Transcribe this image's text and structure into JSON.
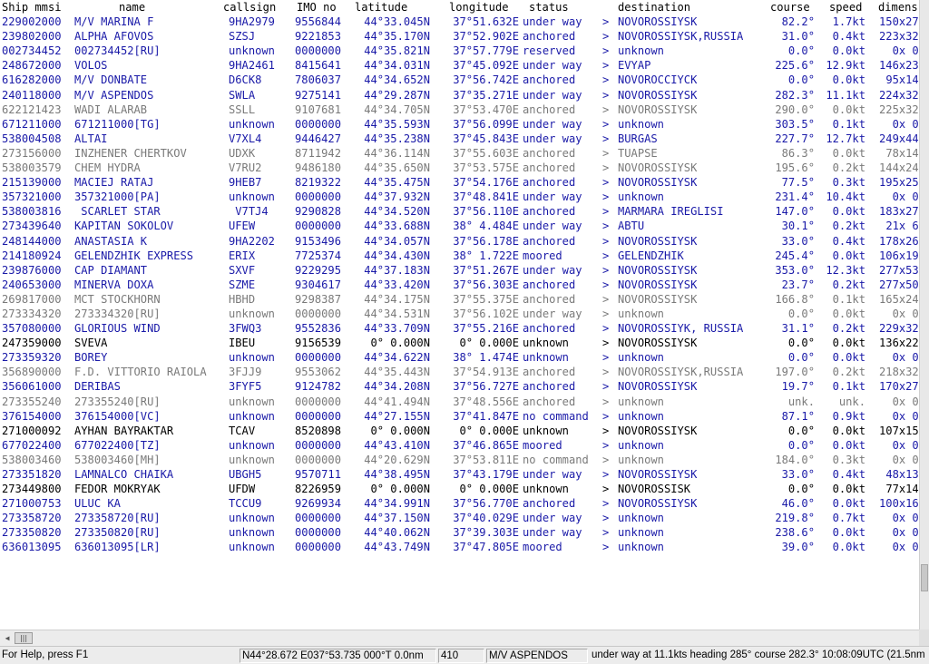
{
  "colors": {
    "moving_text": "#1a1aa8",
    "stationary_text": "#000000",
    "stale_text": "#7a7a7a",
    "header_text": "#000000",
    "background": "#ffffff"
  },
  "table": {
    "columns": [
      "Ship mmsi",
      "name",
      "callsign",
      "IMO no",
      "latitude",
      "longitude",
      "status",
      "destination",
      "course",
      "speed",
      "dimens"
    ],
    "rows": [
      {
        "style": "moving",
        "mmsi": "229002000",
        "name": "M/V MARINA F",
        "callsign": "9HA2979",
        "imo": "9556844",
        "lat": "44°33.045N",
        "lon": "37°51.632E",
        "status": "under way",
        "arrow": ">",
        "dest": "NOVOROSSIYSK",
        "course": "82.2°",
        "speed": "1.7kt",
        "dim": "150x27x"
      },
      {
        "style": "moving",
        "mmsi": "239802000",
        "name": "ALPHA AFOVOS",
        "callsign": "SZSJ",
        "imo": "9221853",
        "lat": "44°35.170N",
        "lon": "37°52.902E",
        "status": "anchored",
        "arrow": ">",
        "dest": "NOVOROSSIYSK,RUSSIA",
        "course": "31.0°",
        "speed": "0.4kt",
        "dim": "223x32x"
      },
      {
        "style": "moving",
        "mmsi": "002734452",
        "name": "002734452[RU]",
        "callsign": "unknown",
        "imo": "0000000",
        "lat": "44°35.821N",
        "lon": "37°57.779E",
        "status": "reserved",
        "arrow": ">",
        "dest": "unknown",
        "course": "0.0°",
        "speed": "0.0kt",
        "dim": "0x 0x"
      },
      {
        "style": "moving",
        "mmsi": "248672000",
        "name": "VOLOS",
        "callsign": "9HA2461",
        "imo": "8415641",
        "lat": "44°34.031N",
        "lon": "37°45.092E",
        "status": "under way",
        "arrow": ">",
        "dest": "EVYAP",
        "course": "225.6°",
        "speed": "12.9kt",
        "dim": "146x23x"
      },
      {
        "style": "moving",
        "mmsi": "616282000",
        "name": "M/V DONBATE",
        "callsign": "D6CK8",
        "imo": "7806037",
        "lat": "44°34.652N",
        "lon": "37°56.742E",
        "status": "anchored",
        "arrow": ">",
        "dest": "NOVOROCCIYCK",
        "course": "0.0°",
        "speed": "0.0kt",
        "dim": "95x14x"
      },
      {
        "style": "moving",
        "mmsi": "240118000",
        "name": "M/V ASPENDOS",
        "callsign": "SWLA",
        "imo": "9275141",
        "lat": "44°29.287N",
        "lon": "37°35.271E",
        "status": "under way",
        "arrow": ">",
        "dest": "NOVOROSSIYSK",
        "course": "282.3°",
        "speed": "11.1kt",
        "dim": "224x32x"
      },
      {
        "style": "stale",
        "mmsi": "622121423",
        "name": "WADI ALARAB",
        "callsign": "SSLL",
        "imo": "9107681",
        "lat": "44°34.705N",
        "lon": "37°53.470E",
        "status": "anchored",
        "arrow": ">",
        "dest": "NOVOROSSIYSK",
        "course": "290.0°",
        "speed": "0.0kt",
        "dim": "225x32x"
      },
      {
        "style": "moving",
        "mmsi": "671211000",
        "name": "671211000[TG]",
        "callsign": "unknown",
        "imo": "0000000",
        "lat": "44°35.593N",
        "lon": "37°56.099E",
        "status": "under way",
        "arrow": ">",
        "dest": "unknown",
        "course": "303.5°",
        "speed": "0.1kt",
        "dim": "0x 0x"
      },
      {
        "style": "moving",
        "mmsi": "538004508",
        "name": "ALTAI",
        "callsign": "V7XL4",
        "imo": "9446427",
        "lat": "44°35.238N",
        "lon": "37°45.843E",
        "status": "under way",
        "arrow": ">",
        "dest": "BURGAS",
        "course": "227.7°",
        "speed": "12.7kt",
        "dim": "249x44x"
      },
      {
        "style": "stale",
        "mmsi": "273156000",
        "name": "INZHENER CHERTKOV",
        "callsign": "UDXK",
        "imo": "8711942",
        "lat": "44°36.114N",
        "lon": "37°55.603E",
        "status": "anchored",
        "arrow": ">",
        "dest": "TUAPSE",
        "course": "86.3°",
        "speed": "0.0kt",
        "dim": "78x14x"
      },
      {
        "style": "stale",
        "mmsi": "538003579",
        "name": "CHEM HYDRA",
        "callsign": "V7RU2",
        "imo": "9486180",
        "lat": "44°35.650N",
        "lon": "37°53.575E",
        "status": "anchored",
        "arrow": ">",
        "dest": "NOVOROSSIYSK",
        "course": "195.6°",
        "speed": "0.2kt",
        "dim": "144x24x"
      },
      {
        "style": "moving",
        "mmsi": "215139000",
        "name": "MACIEJ RATAJ",
        "callsign": "9HEB7",
        "imo": "8219322",
        "lat": "44°35.475N",
        "lon": "37°54.176E",
        "status": "anchored",
        "arrow": ">",
        "dest": "NOVOROSSIYSK",
        "course": "77.5°",
        "speed": "0.3kt",
        "dim": "195x25x"
      },
      {
        "style": "moving",
        "mmsi": "357321000",
        "name": "357321000[PA]",
        "callsign": "unknown",
        "imo": "0000000",
        "lat": "44°37.932N",
        "lon": "37°48.841E",
        "status": "under way",
        "arrow": ">",
        "dest": "unknown",
        "course": "231.4°",
        "speed": "10.4kt",
        "dim": "0x 0x"
      },
      {
        "style": "moving",
        "mmsi": "538003816",
        "name": " SCARLET STAR",
        "callsign": " V7TJ4",
        "imo": "9290828",
        "lat": "44°34.520N",
        "lon": "37°56.110E",
        "status": "anchored",
        "arrow": ">",
        "dest": "MARMARA IREGLISI",
        "course": "147.0°",
        "speed": "0.0kt",
        "dim": "183x27x"
      },
      {
        "style": "moving",
        "mmsi": "273439640",
        "name": "KAPITAN SOKOLOV",
        "callsign": "UFEW",
        "imo": "0000000",
        "lat": "44°33.688N",
        "lon": "38° 4.484E",
        "status": "under way",
        "arrow": ">",
        "dest": "ABTU",
        "course": "30.1°",
        "speed": "0.2kt",
        "dim": "21x 6x"
      },
      {
        "style": "moving",
        "mmsi": "248144000",
        "name": "ANASTASIA K",
        "callsign": "9HA2202",
        "imo": "9153496",
        "lat": "44°34.057N",
        "lon": "37°56.178E",
        "status": "anchored",
        "arrow": ">",
        "dest": "NOVOROSSIYSK",
        "course": "33.0°",
        "speed": "0.4kt",
        "dim": "178x26x"
      },
      {
        "style": "moving",
        "mmsi": "214180924",
        "name": "GELENDZHIK EXPRESS",
        "callsign": "ERIX",
        "imo": "7725374",
        "lat": "44°34.430N",
        "lon": "38° 1.722E",
        "status": "moored",
        "arrow": ">",
        "dest": "GELENDZHIK",
        "course": "245.4°",
        "speed": "0.0kt",
        "dim": "106x19x"
      },
      {
        "style": "moving",
        "mmsi": "239876000",
        "name": "CAP DIAMANT",
        "callsign": "SXVF",
        "imo": "9229295",
        "lat": "44°37.183N",
        "lon": "37°51.267E",
        "status": "under way",
        "arrow": ">",
        "dest": "NOVOROSSIYSK",
        "course": "353.0°",
        "speed": "12.3kt",
        "dim": "277x53x"
      },
      {
        "style": "moving",
        "mmsi": "240653000",
        "name": "MINERVA DOXA",
        "callsign": "SZME",
        "imo": "9304617",
        "lat": "44°33.420N",
        "lon": "37°56.303E",
        "status": "anchored",
        "arrow": ">",
        "dest": "NOVOROSSIYSK",
        "course": "23.7°",
        "speed": "0.2kt",
        "dim": "277x50x"
      },
      {
        "style": "stale",
        "mmsi": "269817000",
        "name": "MCT STOCKHORN",
        "callsign": "HBHD",
        "imo": "9298387",
        "lat": "44°34.175N",
        "lon": "37°55.375E",
        "status": "anchored",
        "arrow": ">",
        "dest": "NOVOROSSIYSK",
        "course": "166.8°",
        "speed": "0.1kt",
        "dim": "165x24x"
      },
      {
        "style": "stale",
        "mmsi": "273334320",
        "name": "273334320[RU]",
        "callsign": "unknown",
        "imo": "0000000",
        "lat": "44°34.531N",
        "lon": "37°56.102E",
        "status": "under way",
        "arrow": ">",
        "dest": "unknown",
        "course": "0.0°",
        "speed": "0.0kt",
        "dim": "0x 0x"
      },
      {
        "style": "moving",
        "mmsi": "357080000",
        "name": "GLORIOUS WIND",
        "callsign": "3FWQ3",
        "imo": "9552836",
        "lat": "44°33.709N",
        "lon": "37°55.216E",
        "status": "anchored",
        "arrow": ">",
        "dest": "NOVOROSSIYK, RUSSIA",
        "course": "31.1°",
        "speed": "0.2kt",
        "dim": "229x32x"
      },
      {
        "style": "dark",
        "mmsi": "247359000",
        "name": "SVEVA",
        "callsign": "IBEU",
        "imo": "9156539",
        "lat": "0° 0.000N",
        "lon": "0° 0.000E",
        "status": "unknown",
        "arrow": ">",
        "dest": "NOVOROSSIYSK",
        "course": "0.0°",
        "speed": "0.0kt",
        "dim": "136x22x"
      },
      {
        "style": "moving",
        "mmsi": "273359320",
        "name": "BOREY",
        "callsign": "unknown",
        "imo": "0000000",
        "lat": "44°34.622N",
        "lon": "38° 1.474E",
        "status": "unknown",
        "arrow": ">",
        "dest": "unknown",
        "course": "0.0°",
        "speed": "0.0kt",
        "dim": "0x 0x"
      },
      {
        "style": "stale",
        "mmsi": "356890000",
        "name": "F.D. VITTORIO RAIOLA",
        "callsign": "3FJJ9",
        "imo": "9553062",
        "lat": "44°35.443N",
        "lon": "37°54.913E",
        "status": "anchored",
        "arrow": ">",
        "dest": "NOVOROSSIYSK,RUSSIA",
        "course": "197.0°",
        "speed": "0.2kt",
        "dim": "218x32x"
      },
      {
        "style": "moving",
        "mmsi": "356061000",
        "name": "DERIBAS",
        "callsign": "3FYF5",
        "imo": "9124782",
        "lat": "44°34.208N",
        "lon": "37°56.727E",
        "status": "anchored",
        "arrow": ">",
        "dest": "NOVOROSSIYSK",
        "course": "19.7°",
        "speed": "0.1kt",
        "dim": "170x27x"
      },
      {
        "style": "stale",
        "mmsi": "273355240",
        "name": "273355240[RU]",
        "callsign": "unknown",
        "imo": "0000000",
        "lat": "44°41.494N",
        "lon": "37°48.556E",
        "status": "anchored",
        "arrow": ">",
        "dest": "unknown",
        "course": "unk.",
        "speed": "unk.",
        "dim": "0x 0x"
      },
      {
        "style": "moving",
        "mmsi": "376154000",
        "name": "376154000[VC]",
        "callsign": "unknown",
        "imo": "0000000",
        "lat": "44°27.155N",
        "lon": "37°41.847E",
        "status": "no command",
        "arrow": ">",
        "dest": "unknown",
        "course": "87.1°",
        "speed": "0.9kt",
        "dim": "0x 0x"
      },
      {
        "style": "dark",
        "mmsi": "271000092",
        "name": "AYHAN BAYRAKTAR",
        "callsign": "TCAV",
        "imo": "8520898",
        "lat": "0° 0.000N",
        "lon": "0° 0.000E",
        "status": "unknown",
        "arrow": ">",
        "dest": "NOVOROSSIYSK",
        "course": "0.0°",
        "speed": "0.0kt",
        "dim": "107x15x"
      },
      {
        "style": "moving",
        "mmsi": "677022400",
        "name": "677022400[TZ]",
        "callsign": "unknown",
        "imo": "0000000",
        "lat": "44°43.410N",
        "lon": "37°46.865E",
        "status": "moored",
        "arrow": ">",
        "dest": "unknown",
        "course": "0.0°",
        "speed": "0.0kt",
        "dim": "0x 0x"
      },
      {
        "style": "stale",
        "mmsi": "538003460",
        "name": "538003460[MH]",
        "callsign": "unknown",
        "imo": "0000000",
        "lat": "44°20.629N",
        "lon": "37°53.811E",
        "status": "no command",
        "arrow": ">",
        "dest": "unknown",
        "course": "184.0°",
        "speed": "0.3kt",
        "dim": "0x 0x"
      },
      {
        "style": "moving",
        "mmsi": "273351820",
        "name": "LAMNALCO CHAIKA",
        "callsign": "UBGH5",
        "imo": "9570711",
        "lat": "44°38.495N",
        "lon": "37°43.179E",
        "status": "under way",
        "arrow": ">",
        "dest": "NOVOROSSIYSK",
        "course": "33.0°",
        "speed": "0.4kt",
        "dim": "48x13x"
      },
      {
        "style": "dark",
        "mmsi": "273449800",
        "name": "FEDOR MOKRYAK",
        "callsign": "UFDW",
        "imo": "8226959",
        "lat": "0° 0.000N",
        "lon": "0° 0.000E",
        "status": "unknown",
        "arrow": ">",
        "dest": "NOVOROSSISK",
        "course": "0.0°",
        "speed": "0.0kt",
        "dim": "77x14x"
      },
      {
        "style": "moving",
        "mmsi": "271000753",
        "name": "ULUC KA",
        "callsign": "TCCU9",
        "imo": "9269934",
        "lat": "44°34.991N",
        "lon": "37°56.770E",
        "status": "anchored",
        "arrow": ">",
        "dest": "NOVOROSSIYSK",
        "course": "46.0°",
        "speed": "0.0kt",
        "dim": "100x16x"
      },
      {
        "style": "moving",
        "mmsi": "273358720",
        "name": "273358720[RU]",
        "callsign": "unknown",
        "imo": "0000000",
        "lat": "44°37.150N",
        "lon": "37°40.029E",
        "status": "under way",
        "arrow": ">",
        "dest": "unknown",
        "course": "219.8°",
        "speed": "0.7kt",
        "dim": "0x 0x"
      },
      {
        "style": "moving",
        "mmsi": "273350820",
        "name": "273350820[RU]",
        "callsign": "unknown",
        "imo": "0000000",
        "lat": "44°40.062N",
        "lon": "37°39.303E",
        "status": "under way",
        "arrow": ">",
        "dest": "unknown",
        "course": "238.6°",
        "speed": "0.0kt",
        "dim": "0x 0x"
      },
      {
        "style": "moving",
        "mmsi": "636013095",
        "name": "636013095[LR]",
        "callsign": "unknown",
        "imo": "0000000",
        "lat": "44°43.749N",
        "lon": "37°47.805E",
        "status": "moored",
        "arrow": ">",
        "dest": "unknown",
        "course": "39.0°",
        "speed": "0.0kt",
        "dim": "0x 0x"
      }
    ]
  },
  "scrollbar": {
    "thumb_grip": "|||"
  },
  "statusbar": {
    "help": "For Help, press F1",
    "cursor_position": "N44°28.672 E037°53.735 000°T 0.0nm",
    "count": "410",
    "selected_ship": "M/V ASPENDOS",
    "selected_info": "under way  at 11.1kts heading 285° course 282.3° 10:08:09UTC (21.5nm"
  }
}
